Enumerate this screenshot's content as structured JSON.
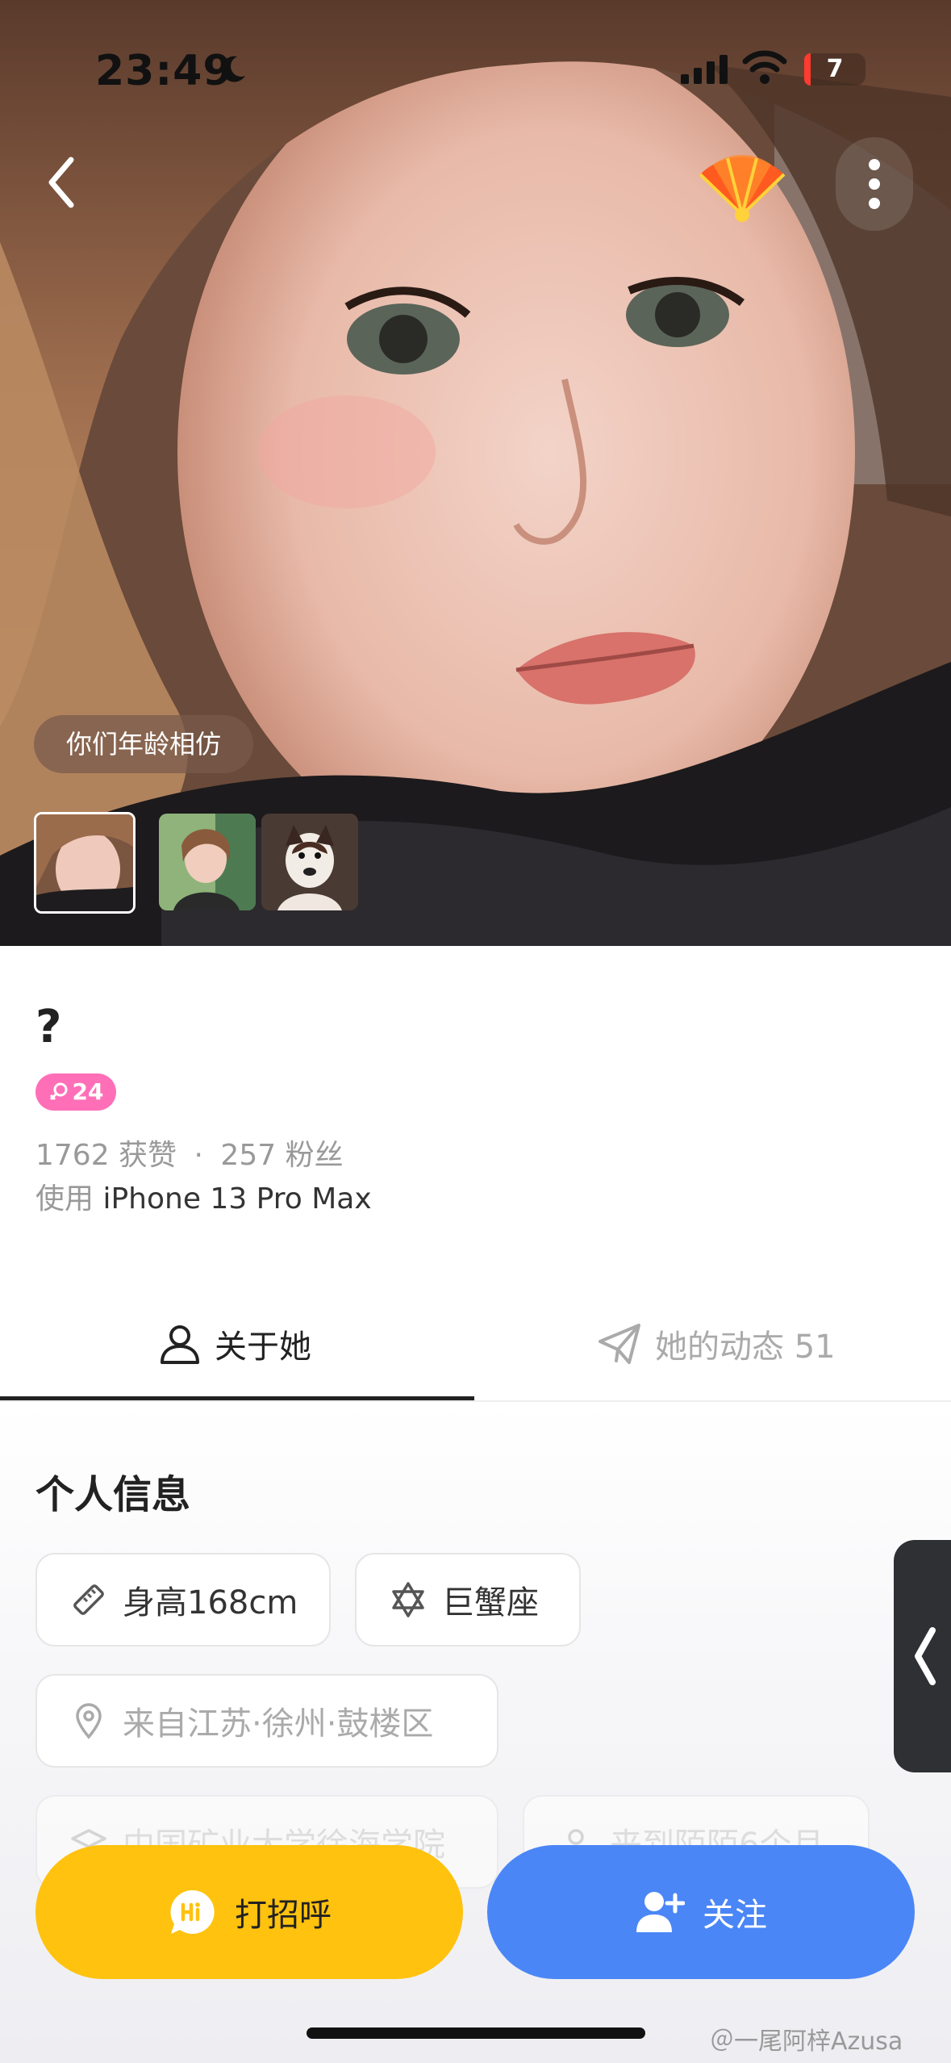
{
  "status_bar": {
    "time": "23:49",
    "battery": "7"
  },
  "header": {
    "age_tag": "你们年龄相仿"
  },
  "profile": {
    "name": "?",
    "age": "24",
    "likes": "1762 获赞",
    "separator": "·",
    "fans": "257 粉丝",
    "device_prefix": "使用",
    "device_model": "iPhone 13 Pro Max"
  },
  "tabs": [
    {
      "label": "关于她"
    },
    {
      "label": "她的动态 51"
    }
  ],
  "info": {
    "title": "个人信息",
    "height": "身高168cm",
    "zodiac": "巨蟹座",
    "hometown": "来自江苏·徐州·鼓楼区",
    "school": "中国矿业大学徐海学院",
    "joined": "来到陌陌6个月"
  },
  "actions": {
    "greet": "打招呼",
    "follow": "关注"
  },
  "watermark": "＠一尾阿梓Azusa",
  "colors": {
    "greet": "#ffc20e",
    "follow": "#4b86f7",
    "female_badge": "#ff6fb8"
  },
  "icons": [
    "back-icon",
    "fan-icon",
    "more-icon",
    "person-icon",
    "send-icon",
    "ruler-icon",
    "star-of-david-icon",
    "location-icon",
    "hi-bubble-icon",
    "add-user-icon"
  ]
}
